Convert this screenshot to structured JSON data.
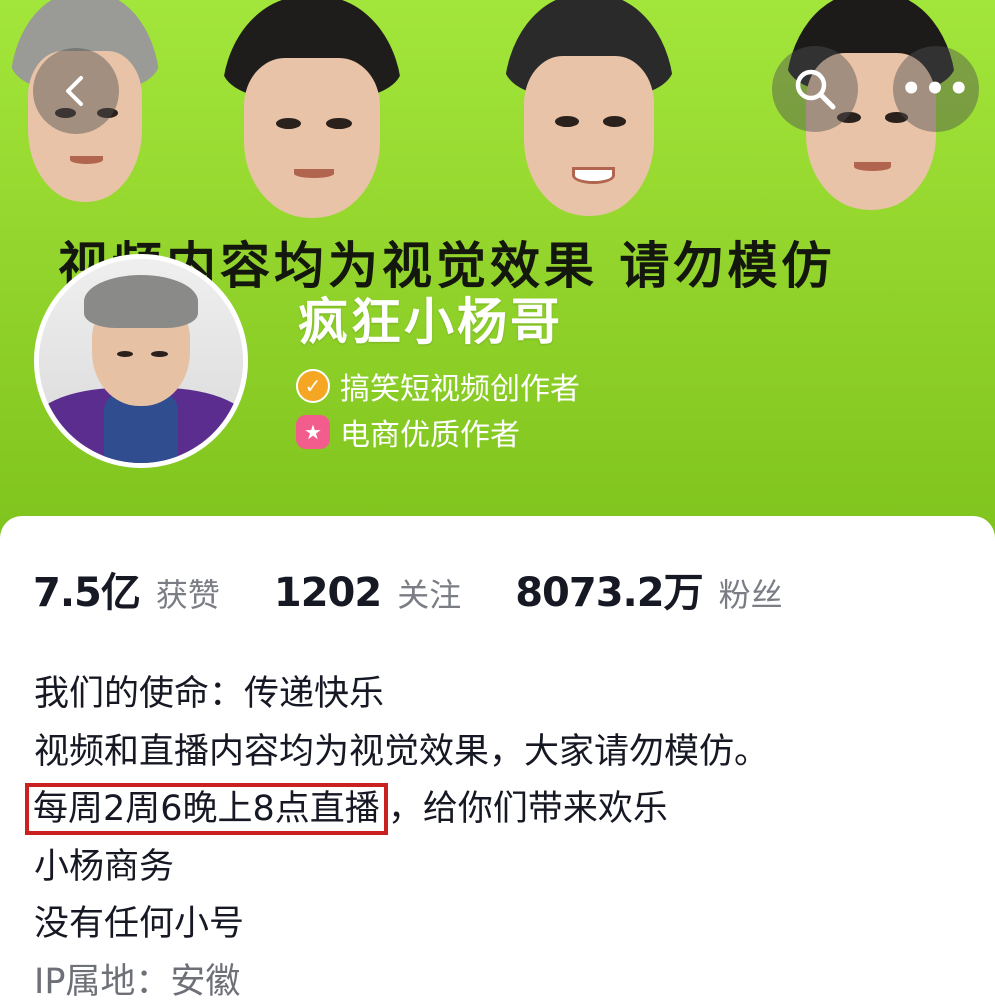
{
  "header": {
    "banner_slogan": "视频内容均为视觉效果  请勿模仿",
    "back_icon": "chevron-left-icon",
    "search_icon": "search-icon",
    "more_label": "•••"
  },
  "profile": {
    "nickname": "疯狂小杨哥",
    "badges": [
      {
        "icon": "check-badge-icon",
        "label": "搞笑短视频创作者",
        "color": "#f5a623"
      },
      {
        "icon": "star-badge-icon",
        "label": "电商优质作者",
        "color": "#f25d8e"
      }
    ]
  },
  "stats": [
    {
      "value": "7.5亿",
      "label": "获赞"
    },
    {
      "value": "1202",
      "label": "关注"
    },
    {
      "value": "8073.2万",
      "label": "粉丝"
    }
  ],
  "bio": {
    "line1": "我们的使命：传递快乐",
    "line2": "视频和直播内容均为视觉效果，大家请勿模仿。",
    "line3_highlight": "每周2周6晚上8点直播",
    "line3_rest": "，给你们带来欢乐",
    "line4": "小杨商务",
    "line5": "没有任何小号",
    "ip_label": "IP属地：安徽"
  },
  "colors": {
    "banner_green": "#93d52c",
    "highlight_border": "#c8211f"
  }
}
